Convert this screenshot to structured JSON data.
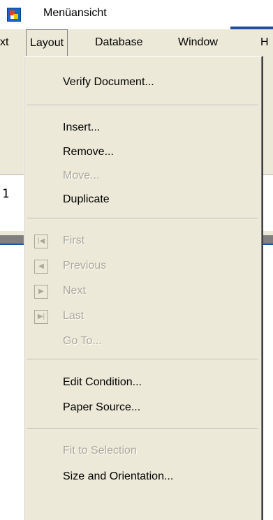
{
  "window": {
    "title": "Menüansicht"
  },
  "menubar": {
    "items": [
      {
        "label": "xt"
      },
      {
        "label": "Layout"
      },
      {
        "label": "Database"
      },
      {
        "label": "Window"
      },
      {
        "label": "H"
      }
    ]
  },
  "ruler": {
    "number": "1"
  },
  "layout_menu": {
    "items": [
      {
        "label": "Verify Document...",
        "enabled": true
      },
      {
        "label": "Insert...",
        "enabled": true
      },
      {
        "label": "Remove...",
        "enabled": true
      },
      {
        "label": "Move...",
        "enabled": false
      },
      {
        "label": "Duplicate",
        "enabled": true
      },
      {
        "label": "First",
        "enabled": false,
        "icon": "first-record-icon"
      },
      {
        "label": "Previous",
        "enabled": false,
        "icon": "previous-record-icon"
      },
      {
        "label": "Next",
        "enabled": false,
        "icon": "next-record-icon"
      },
      {
        "label": "Last",
        "enabled": false,
        "icon": "last-record-icon"
      },
      {
        "label": "Go To...",
        "enabled": false
      },
      {
        "label": "Edit Condition...",
        "enabled": true
      },
      {
        "label": "Paper Source...",
        "enabled": true
      },
      {
        "label": "Fit to Selection",
        "enabled": false
      },
      {
        "label": "Size and Orientation...",
        "enabled": true
      }
    ]
  }
}
